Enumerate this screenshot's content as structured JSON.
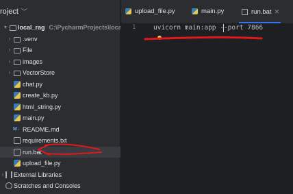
{
  "project_header": {
    "title": "roject",
    "chevron": "chevron-down-icon"
  },
  "tree": {
    "root": {
      "name": "local_rag",
      "path": "C:\\PycharmProjects\\local_rag"
    },
    "items": [
      {
        "label": ".venv",
        "type": "folder"
      },
      {
        "label": "File",
        "type": "folder"
      },
      {
        "label": "images",
        "type": "folder"
      },
      {
        "label": "VectorStore",
        "type": "folder"
      },
      {
        "label": "chat.py",
        "type": "python"
      },
      {
        "label": "create_kb.py",
        "type": "python"
      },
      {
        "label": "html_string.py",
        "type": "python"
      },
      {
        "label": "main.py",
        "type": "python"
      },
      {
        "label": "README.md",
        "type": "markdown"
      },
      {
        "label": "requirements.txt",
        "type": "text"
      },
      {
        "label": "run.bat",
        "type": "batch"
      },
      {
        "label": "upload_file.py",
        "type": "python"
      }
    ],
    "external_libraries": "External Libraries",
    "scratches": "Scratches and Consoles"
  },
  "tabs": [
    {
      "label": "upload_file.py"
    },
    {
      "label": "main.py"
    },
    {
      "label": "run.bat",
      "active": true
    }
  ],
  "editor": {
    "line_number": "1",
    "code": "uvicorn main:app --port 7866"
  },
  "colors": {
    "accent": "#3574f0",
    "annotation": "#e0191b",
    "python_blue": "#3d7ab8",
    "python_yellow": "#e8c84a"
  }
}
